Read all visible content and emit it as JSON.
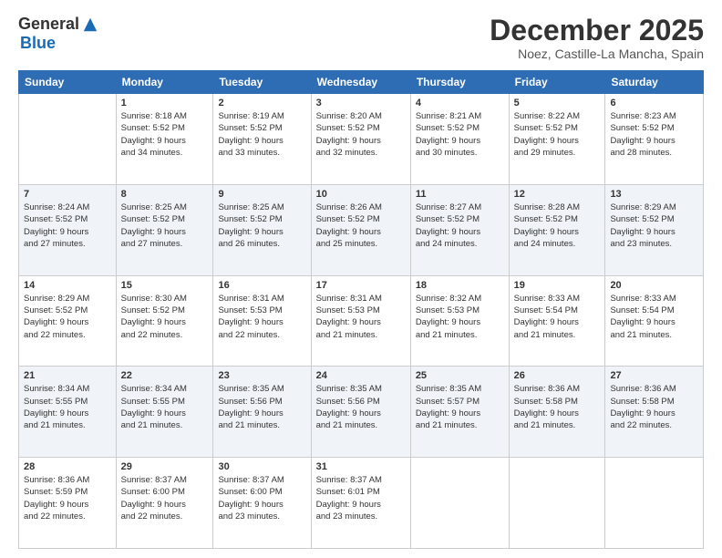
{
  "logo": {
    "general": "General",
    "blue": "Blue"
  },
  "header": {
    "month": "December 2025",
    "location": "Noez, Castille-La Mancha, Spain"
  },
  "weekdays": [
    "Sunday",
    "Monday",
    "Tuesday",
    "Wednesday",
    "Thursday",
    "Friday",
    "Saturday"
  ],
  "weeks": [
    [
      {
        "day": "",
        "info": ""
      },
      {
        "day": "1",
        "info": "Sunrise: 8:18 AM\nSunset: 5:52 PM\nDaylight: 9 hours\nand 34 minutes."
      },
      {
        "day": "2",
        "info": "Sunrise: 8:19 AM\nSunset: 5:52 PM\nDaylight: 9 hours\nand 33 minutes."
      },
      {
        "day": "3",
        "info": "Sunrise: 8:20 AM\nSunset: 5:52 PM\nDaylight: 9 hours\nand 32 minutes."
      },
      {
        "day": "4",
        "info": "Sunrise: 8:21 AM\nSunset: 5:52 PM\nDaylight: 9 hours\nand 30 minutes."
      },
      {
        "day": "5",
        "info": "Sunrise: 8:22 AM\nSunset: 5:52 PM\nDaylight: 9 hours\nand 29 minutes."
      },
      {
        "day": "6",
        "info": "Sunrise: 8:23 AM\nSunset: 5:52 PM\nDaylight: 9 hours\nand 28 minutes."
      }
    ],
    [
      {
        "day": "7",
        "info": "Sunrise: 8:24 AM\nSunset: 5:52 PM\nDaylight: 9 hours\nand 27 minutes."
      },
      {
        "day": "8",
        "info": "Sunrise: 8:25 AM\nSunset: 5:52 PM\nDaylight: 9 hours\nand 27 minutes."
      },
      {
        "day": "9",
        "info": "Sunrise: 8:25 AM\nSunset: 5:52 PM\nDaylight: 9 hours\nand 26 minutes."
      },
      {
        "day": "10",
        "info": "Sunrise: 8:26 AM\nSunset: 5:52 PM\nDaylight: 9 hours\nand 25 minutes."
      },
      {
        "day": "11",
        "info": "Sunrise: 8:27 AM\nSunset: 5:52 PM\nDaylight: 9 hours\nand 24 minutes."
      },
      {
        "day": "12",
        "info": "Sunrise: 8:28 AM\nSunset: 5:52 PM\nDaylight: 9 hours\nand 24 minutes."
      },
      {
        "day": "13",
        "info": "Sunrise: 8:29 AM\nSunset: 5:52 PM\nDaylight: 9 hours\nand 23 minutes."
      }
    ],
    [
      {
        "day": "14",
        "info": "Sunrise: 8:29 AM\nSunset: 5:52 PM\nDaylight: 9 hours\nand 22 minutes."
      },
      {
        "day": "15",
        "info": "Sunrise: 8:30 AM\nSunset: 5:52 PM\nDaylight: 9 hours\nand 22 minutes."
      },
      {
        "day": "16",
        "info": "Sunrise: 8:31 AM\nSunset: 5:53 PM\nDaylight: 9 hours\nand 22 minutes."
      },
      {
        "day": "17",
        "info": "Sunrise: 8:31 AM\nSunset: 5:53 PM\nDaylight: 9 hours\nand 21 minutes."
      },
      {
        "day": "18",
        "info": "Sunrise: 8:32 AM\nSunset: 5:53 PM\nDaylight: 9 hours\nand 21 minutes."
      },
      {
        "day": "19",
        "info": "Sunrise: 8:33 AM\nSunset: 5:54 PM\nDaylight: 9 hours\nand 21 minutes."
      },
      {
        "day": "20",
        "info": "Sunrise: 8:33 AM\nSunset: 5:54 PM\nDaylight: 9 hours\nand 21 minutes."
      }
    ],
    [
      {
        "day": "21",
        "info": "Sunrise: 8:34 AM\nSunset: 5:55 PM\nDaylight: 9 hours\nand 21 minutes."
      },
      {
        "day": "22",
        "info": "Sunrise: 8:34 AM\nSunset: 5:55 PM\nDaylight: 9 hours\nand 21 minutes."
      },
      {
        "day": "23",
        "info": "Sunrise: 8:35 AM\nSunset: 5:56 PM\nDaylight: 9 hours\nand 21 minutes."
      },
      {
        "day": "24",
        "info": "Sunrise: 8:35 AM\nSunset: 5:56 PM\nDaylight: 9 hours\nand 21 minutes."
      },
      {
        "day": "25",
        "info": "Sunrise: 8:35 AM\nSunset: 5:57 PM\nDaylight: 9 hours\nand 21 minutes."
      },
      {
        "day": "26",
        "info": "Sunrise: 8:36 AM\nSunset: 5:58 PM\nDaylight: 9 hours\nand 21 minutes."
      },
      {
        "day": "27",
        "info": "Sunrise: 8:36 AM\nSunset: 5:58 PM\nDaylight: 9 hours\nand 22 minutes."
      }
    ],
    [
      {
        "day": "28",
        "info": "Sunrise: 8:36 AM\nSunset: 5:59 PM\nDaylight: 9 hours\nand 22 minutes."
      },
      {
        "day": "29",
        "info": "Sunrise: 8:37 AM\nSunset: 6:00 PM\nDaylight: 9 hours\nand 22 minutes."
      },
      {
        "day": "30",
        "info": "Sunrise: 8:37 AM\nSunset: 6:00 PM\nDaylight: 9 hours\nand 23 minutes."
      },
      {
        "day": "31",
        "info": "Sunrise: 8:37 AM\nSunset: 6:01 PM\nDaylight: 9 hours\nand 23 minutes."
      },
      {
        "day": "",
        "info": ""
      },
      {
        "day": "",
        "info": ""
      },
      {
        "day": "",
        "info": ""
      }
    ]
  ]
}
